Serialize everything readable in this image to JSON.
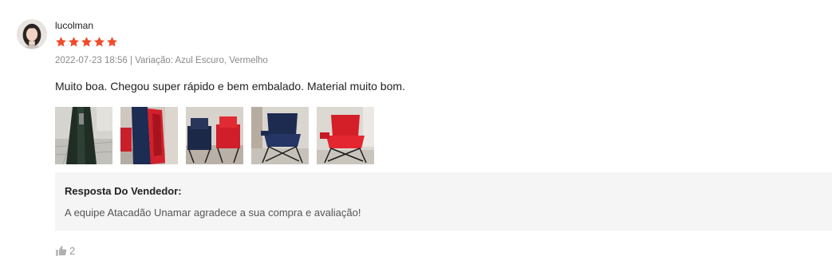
{
  "review": {
    "username": "lucolman",
    "rating": 5,
    "star_color": "#ee4d2d",
    "date": "2022-07-23 18:56",
    "separator": " | ",
    "variation": "Variação: Azul Escuro, Vermelho",
    "comment": "Muito boa. Chegou super rápido e bem embalado. Material muito bom.",
    "photo_count": 5,
    "seller_reply": {
      "title": "Resposta Do Vendedor:",
      "text": "A equipe Atacadão Unamar agradece a sua compra e avaliação!"
    },
    "likes": "2"
  },
  "icons": {
    "avatar": "user-avatar-photo",
    "star": "star-icon",
    "like": "thumbs-up-icon"
  },
  "colors": {
    "reply_background": "#f5f5f5",
    "meta_text": "#8a8a8a"
  }
}
